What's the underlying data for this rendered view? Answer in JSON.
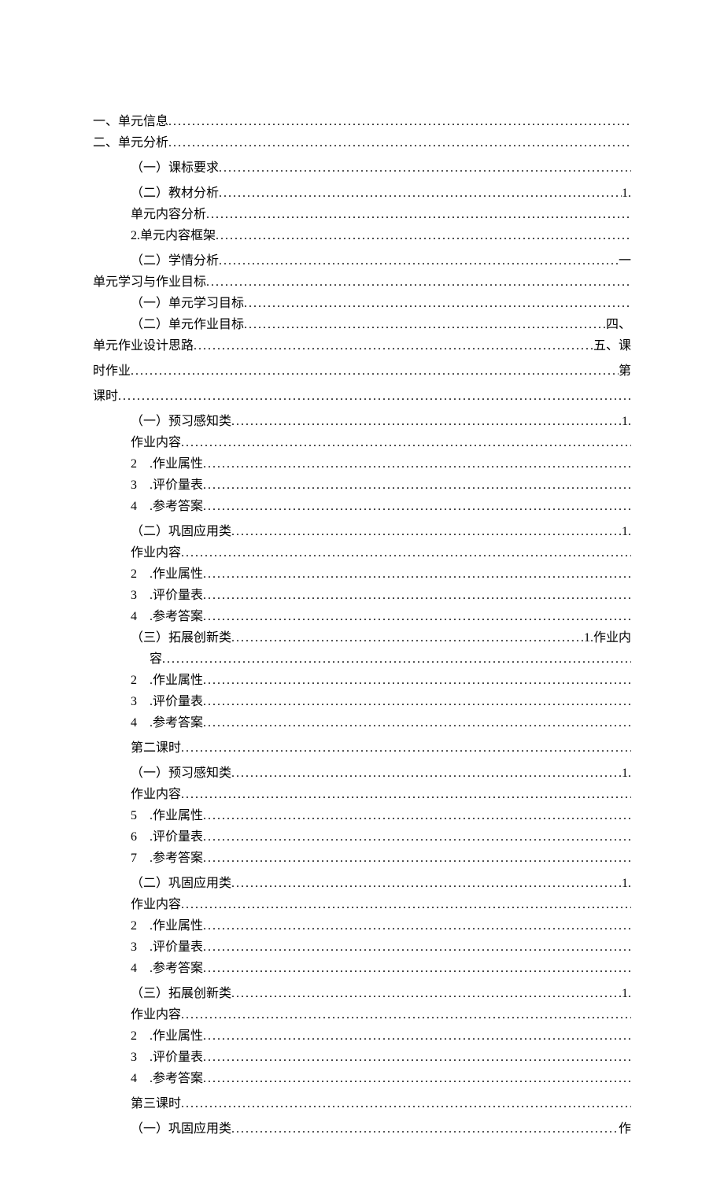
{
  "toc": [
    {
      "left": "一、单元信息",
      "right": "",
      "indent": 0,
      "gap": 0,
      "tail": ""
    },
    {
      "left": "二、单元分析",
      "right": "",
      "indent": 0,
      "gap": 0,
      "tail": ""
    },
    {
      "left": "（一）课标要求",
      "right": "",
      "indent": 1,
      "gap": 1,
      "tail": ""
    },
    {
      "left": "（二）教材分析",
      "right": "1.",
      "indent": 1,
      "gap": 1,
      "tail": ""
    },
    {
      "left": "单元内容分析",
      "right": "",
      "indent": 2,
      "gap": 0,
      "tail": ""
    },
    {
      "left": "2.单元内容框架",
      "right": "",
      "indent": 2,
      "gap": 0,
      "tail": ""
    },
    {
      "left": "（二）学情分析",
      "right": "一",
      "indent": 1,
      "gap": 1,
      "tail": ""
    },
    {
      "left": "单元学习与作业目标",
      "right": "",
      "indent": 0,
      "gap": 0,
      "tail": ""
    },
    {
      "left": "（一）单元学习目标",
      "right": "",
      "indent": 1,
      "gap": 0,
      "tail": ""
    },
    {
      "left": "（二）单元作业目标",
      "right": "四、",
      "indent": 1,
      "gap": 0,
      "tail": ""
    },
    {
      "left": "单元作业设计思路",
      "right": "五、课",
      "indent": 0,
      "gap": 0,
      "tail": ""
    },
    {
      "left": "时作业",
      "right": "第",
      "indent": 0,
      "gap": 1,
      "tail": ""
    },
    {
      "left": "课时",
      "right": "",
      "indent": 0,
      "gap": 1,
      "tail": ""
    },
    {
      "left": "（一）预习感知类",
      "right": "1.",
      "indent": 1,
      "gap": 1,
      "tail": ""
    },
    {
      "left": "作业内容",
      "right": "",
      "indent": 2,
      "gap": 0,
      "tail": ""
    },
    {
      "left": "2　.作业属性",
      "right": "",
      "indent": 2,
      "gap": 0,
      "tail": ""
    },
    {
      "left": "3　.评价量表",
      "right": "",
      "indent": 2,
      "gap": 0,
      "tail": ""
    },
    {
      "left": "4　.参考答案",
      "right": "",
      "indent": 2,
      "gap": 0,
      "tail": ""
    },
    {
      "left": "（二）巩固应用类",
      "right": "1.",
      "indent": 1,
      "gap": 1,
      "tail": ""
    },
    {
      "left": "作业内容",
      "right": "",
      "indent": 2,
      "gap": 0,
      "tail": ""
    },
    {
      "left": "2　.作业属性",
      "right": "",
      "indent": 2,
      "gap": 0,
      "tail": ""
    },
    {
      "left": "3　.评价量表",
      "right": "",
      "indent": 2,
      "gap": 0,
      "tail": ""
    },
    {
      "left": "4　.参考答案",
      "right": "",
      "indent": 2,
      "gap": 0,
      "tail": ""
    },
    {
      "left": "（三）拓展创新类",
      "right": "1.作业内",
      "indent": 1,
      "gap": 0,
      "tail": ""
    },
    {
      "left": "容",
      "right": "",
      "indent": 3,
      "gap": 0,
      "tail": ""
    },
    {
      "left": "2　.作业属性",
      "right": "",
      "indent": 2,
      "gap": 0,
      "tail": ""
    },
    {
      "left": "3　.评价量表",
      "right": "",
      "indent": 2,
      "gap": 0,
      "tail": ""
    },
    {
      "left": "4　.参考答案",
      "right": "",
      "indent": 2,
      "gap": 0,
      "tail": ""
    },
    {
      "left": "第二课时",
      "right": "",
      "indent": 4,
      "gap": 1,
      "tail": ""
    },
    {
      "left": "（一）预习感知类",
      "right": "1.",
      "indent": 1,
      "gap": 1,
      "tail": ""
    },
    {
      "left": "作业内容",
      "right": "",
      "indent": 2,
      "gap": 0,
      "tail": ""
    },
    {
      "left": "5　.作业属性",
      "right": "",
      "indent": 2,
      "gap": 0,
      "tail": ""
    },
    {
      "left": "6　.评价量表",
      "right": "",
      "indent": 2,
      "gap": 0,
      "tail": ""
    },
    {
      "left": "7　.参考答案",
      "right": "",
      "indent": 2,
      "gap": 0,
      "tail": ""
    },
    {
      "left": "（二）巩固应用类",
      "right": "1.",
      "indent": 1,
      "gap": 1,
      "tail": ""
    },
    {
      "left": "作业内容",
      "right": "",
      "indent": 2,
      "gap": 0,
      "tail": ""
    },
    {
      "left": "2　.作业属性",
      "right": "",
      "indent": 2,
      "gap": 0,
      "tail": ""
    },
    {
      "left": "3　.评价量表",
      "right": "",
      "indent": 2,
      "gap": 0,
      "tail": ""
    },
    {
      "left": "4　.参考答案",
      "right": "",
      "indent": 2,
      "gap": 0,
      "tail": ""
    },
    {
      "left": "（三）拓展创新类",
      "right": "1.",
      "indent": 1,
      "gap": 1,
      "tail": ""
    },
    {
      "left": "作业内容",
      "right": "",
      "indent": 2,
      "gap": 0,
      "tail": ""
    },
    {
      "left": "2　.作业属性",
      "right": "",
      "indent": 2,
      "gap": 0,
      "tail": ""
    },
    {
      "left": "3　.评价量表",
      "right": "",
      "indent": 2,
      "gap": 0,
      "tail": ""
    },
    {
      "left": "4　.参考答案",
      "right": "",
      "indent": 2,
      "gap": 0,
      "tail": ""
    },
    {
      "left": "第三课时",
      "right": "",
      "indent": 4,
      "gap": 1,
      "tail": ""
    },
    {
      "left": "（一）巩固应用类",
      "right": "作",
      "indent": 1,
      "gap": 1,
      "tail": ""
    }
  ]
}
